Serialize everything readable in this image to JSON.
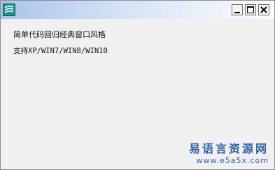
{
  "window": {
    "title": "",
    "icon": "app-logo-icon",
    "controls": {
      "minimize": "minimize-icon",
      "maximize": "maximize-icon",
      "close": "close-icon"
    }
  },
  "content": {
    "label_1": "简单代码回归经典窗口风格",
    "label_2": "支持XP/WIN7/WIN8/WIN10"
  },
  "watermark": {
    "title": "易语言资源网",
    "url": "www.e5a5x.com"
  },
  "colors": {
    "title_gradient_start": "#a9c4ea",
    "title_gradient_end": "#fbfcfe",
    "client_bg": "#f0f0f0",
    "watermark": "#2f62a8"
  }
}
